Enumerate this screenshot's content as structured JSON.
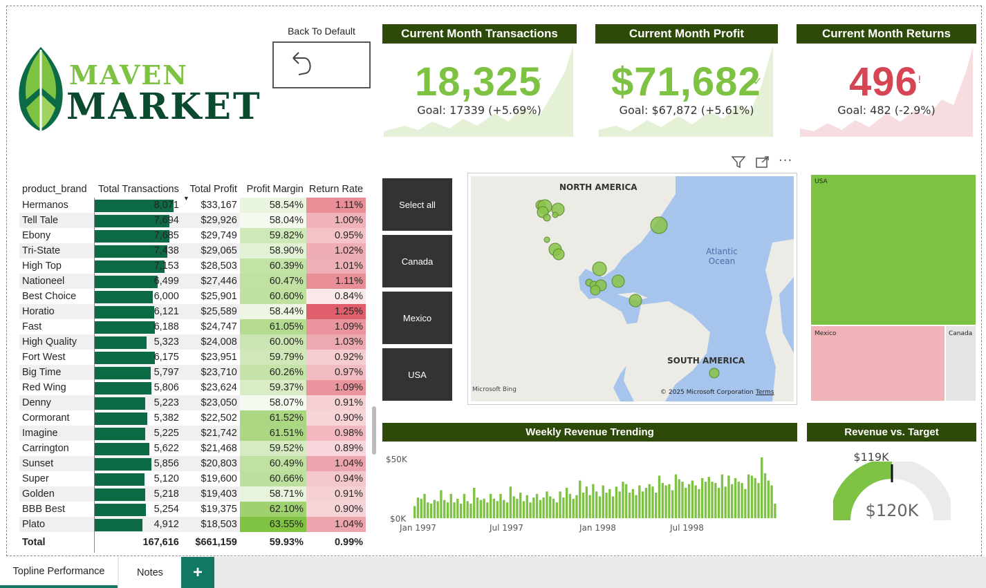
{
  "logo": {
    "line1": "MAVEN",
    "line2": "MARKET"
  },
  "back_button": {
    "label": "Back To Default"
  },
  "kpis": [
    {
      "title": "Current Month Transactions",
      "value": "18,325",
      "status": "✓",
      "goal": "Goal: 17339 (+5.69%)"
    },
    {
      "title": "Current Month Profit",
      "value": "$71,682",
      "status": "✓",
      "goal": "Goal: $67,872 (+5.61%)"
    },
    {
      "title": "Current Month Returns",
      "value": "496",
      "status": "!",
      "goal": "Goal: 482 (-2.9%)"
    }
  ],
  "colors": {
    "header_green": "#2d4a08",
    "good": "#7dc242",
    "bad": "#d64554",
    "bar_dark": "#0c6b45"
  },
  "table": {
    "columns": [
      "product_brand",
      "Total Transactions",
      "Total Profit",
      "Profit Margin",
      "Return Rate"
    ],
    "rows": [
      [
        "Hermanos",
        "8,071",
        "$33,167",
        "58.54%",
        "1.11%"
      ],
      [
        "Tell Tale",
        "7,694",
        "$29,926",
        "58.04%",
        "1.00%"
      ],
      [
        "Ebony",
        "7,685",
        "$29,749",
        "59.82%",
        "0.95%"
      ],
      [
        "Tri-State",
        "7,438",
        "$29,065",
        "58.90%",
        "1.02%"
      ],
      [
        "High Top",
        "7,153",
        "$28,503",
        "60.39%",
        "1.01%"
      ],
      [
        "Nationeel",
        "6,499",
        "$27,446",
        "60.47%",
        "1.11%"
      ],
      [
        "Best Choice",
        "6,000",
        "$25,901",
        "60.60%",
        "0.84%"
      ],
      [
        "Horatio",
        "6,121",
        "$25,589",
        "58.44%",
        "1.25%"
      ],
      [
        "Fast",
        "6,188",
        "$24,747",
        "61.05%",
        "1.09%"
      ],
      [
        "High Quality",
        "5,323",
        "$24,008",
        "60.00%",
        "1.03%"
      ],
      [
        "Fort West",
        "6,175",
        "$23,951",
        "59.79%",
        "0.92%"
      ],
      [
        "Big Time",
        "5,797",
        "$23,710",
        "60.26%",
        "0.97%"
      ],
      [
        "Red Wing",
        "5,806",
        "$23,624",
        "59.37%",
        "1.09%"
      ],
      [
        "Denny",
        "5,223",
        "$23,050",
        "58.07%",
        "0.91%"
      ],
      [
        "Cormorant",
        "5,382",
        "$22,502",
        "61.52%",
        "0.90%"
      ],
      [
        "Imagine",
        "5,225",
        "$21,742",
        "61.51%",
        "0.98%"
      ],
      [
        "Carrington",
        "5,622",
        "$21,468",
        "59.52%",
        "0.89%"
      ],
      [
        "Sunset",
        "5,856",
        "$20,803",
        "60.49%",
        "1.04%"
      ],
      [
        "Super",
        "5,120",
        "$19,600",
        "60.66%",
        "0.94%"
      ],
      [
        "Golden",
        "5,218",
        "$19,403",
        "58.71%",
        "0.91%"
      ],
      [
        "BBB Best",
        "5,254",
        "$19,375",
        "62.10%",
        "0.90%"
      ],
      [
        "Plato",
        "4,912",
        "$18,503",
        "63.55%",
        "1.04%"
      ]
    ],
    "total": [
      "Total",
      "167,616",
      "$661,159",
      "59.93%",
      "0.99%"
    ]
  },
  "slicers": [
    "Select all",
    "Canada",
    "Mexico",
    "USA"
  ],
  "map": {
    "labels": {
      "na": "NORTH AMERICA",
      "sa": "SOUTH AMERICA",
      "ocean1": "Atlantic",
      "ocean2": "Ocean"
    },
    "credit": "Microsoft Bing",
    "copyright": "© 2025 Microsoft Corporation",
    "terms": "Terms"
  },
  "treemap": {
    "cells": [
      "USA",
      "Mexico",
      "Canada"
    ]
  },
  "weekly": {
    "title": "Weekly Revenue Trending",
    "y_ticks": [
      "$50K",
      "$0K"
    ],
    "x_ticks": [
      "Jan 1997",
      "Jul 1997",
      "Jan 1998",
      "Jul 1998"
    ]
  },
  "gauge": {
    "title": "Revenue vs. Target",
    "target_label": "$119K",
    "value_label": "$120K",
    "fill_fraction": 0.5
  },
  "tabs": [
    "Topline Performance",
    "Notes"
  ],
  "chart_data": {
    "type": "bar",
    "title": "Weekly Revenue Trending",
    "ylim": [
      0,
      50000
    ],
    "x_ticks": [
      "Jan 1997",
      "Jul 1997",
      "Jan 1998",
      "Jul 1998"
    ],
    "series": [
      {
        "values": [
          10000,
          17000,
          16000,
          20000,
          13000,
          12000,
          15000,
          14000,
          23000,
          15000,
          13000,
          20000,
          13000,
          16000,
          12000,
          20000,
          14000,
          12000,
          25000,
          17000,
          15000,
          16000,
          13000,
          20000,
          16000,
          14000,
          20000,
          15000,
          13000,
          26000,
          18000,
          16000,
          21000,
          14000,
          19000,
          13000,
          17000,
          20000,
          15000,
          17000,
          22000,
          18000,
          16000,
          13000,
          22000,
          17000,
          25000,
          20000,
          16000,
          19000,
          31000,
          21000,
          26000,
          19000,
          28000,
          22000,
          18000,
          27000,
          21000,
          24000,
          18000,
          26000,
          22000,
          30000,
          28000,
          21000,
          24000,
          19000,
          27000,
          22000,
          25000,
          28000,
          26000,
          21000,
          35000,
          29000,
          27000,
          28000,
          23000,
          36000,
          32000,
          30000,
          25000,
          28000,
          31000,
          27000,
          24000,
          33000,
          30000,
          34000,
          30000,
          29000,
          25000,
          36000,
          26000,
          35000,
          28000,
          33000,
          30000,
          29000,
          24000,
          36000,
          35000,
          33000,
          29000,
          50000,
          37000,
          31000,
          27000,
          12000
        ]
      }
    ]
  }
}
